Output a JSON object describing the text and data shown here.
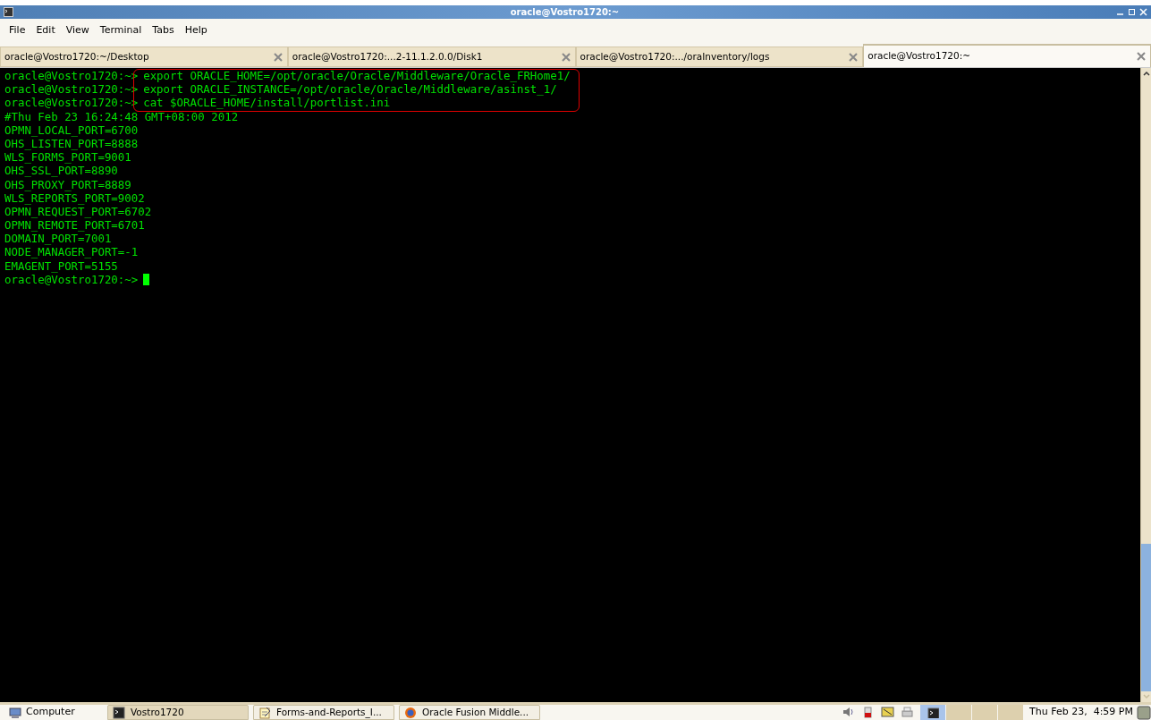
{
  "window": {
    "title": "oracle@Vostro1720:~"
  },
  "menu": [
    "File",
    "Edit",
    "View",
    "Terminal",
    "Tabs",
    "Help"
  ],
  "tabs": [
    {
      "label": "oracle@Vostro1720:~/Desktop",
      "selected": false
    },
    {
      "label": "oracle@Vostro1720:...2-11.1.2.0.0/Disk1",
      "selected": false
    },
    {
      "label": "oracle@Vostro1720:.../oraInventory/logs",
      "selected": false
    },
    {
      "label": "oracle@Vostro1720:~",
      "selected": true
    }
  ],
  "terminal": {
    "lines": [
      {
        "prompt": "oracle@Vostro1720:~>",
        "text": "export ORACLE_HOME=/opt/oracle/Oracle/Middleware/Oracle_FRHome1/",
        "highlighted": true
      },
      {
        "prompt": "oracle@Vostro1720:~>",
        "text": "export ORACLE_INSTANCE=/opt/oracle/Oracle/Middleware/asinst_1/",
        "highlighted": true
      },
      {
        "prompt": "oracle@Vostro1720:~>",
        "text": "cat $ORACLE_HOME/install/portlist.ini",
        "highlighted": true
      },
      {
        "text": "#Thu Feb 23 16:24:48 GMT+08:00 2012",
        "highlighted": false
      },
      {
        "text": "OPMN_LOCAL_PORT=6700",
        "highlighted": false
      },
      {
        "text": "OHS_LISTEN_PORT=8888",
        "highlighted": false
      },
      {
        "text": "WLS_FORMS_PORT=9001",
        "highlighted": false
      },
      {
        "text": "OHS_SSL_PORT=8890",
        "highlighted": false
      },
      {
        "text": "OHS_PROXY_PORT=8889",
        "highlighted": false
      },
      {
        "text": "WLS_REPORTS_PORT=9002",
        "highlighted": false
      },
      {
        "text": "OPMN_REQUEST_PORT=6702",
        "highlighted": false
      },
      {
        "text": "OPMN_REMOTE_PORT=6701",
        "highlighted": false
      },
      {
        "text": "DOMAIN_PORT=7001",
        "highlighted": false
      },
      {
        "text": "NODE_MANAGER_PORT=-1",
        "highlighted": false
      },
      {
        "text": "EMAGENT_PORT=5155",
        "highlighted": false
      },
      {
        "prompt": "oracle@Vostro1720:~>",
        "cursor": true,
        "highlighted": false
      }
    ]
  },
  "taskbar": {
    "launcher": "Computer",
    "tasks": [
      {
        "label": "Vostro1720",
        "kind": "terminal",
        "selected": true
      },
      {
        "label": "Forms-and-Reports_I...",
        "kind": "editor",
        "selected": false
      },
      {
        "label": "Oracle Fusion Middle...",
        "kind": "browser",
        "selected": false
      }
    ],
    "workspaces": [
      {
        "selected": true
      },
      {
        "selected": false
      },
      {
        "selected": false
      },
      {
        "selected": false
      }
    ],
    "clock": "Thu Feb 23,  4:59 PM"
  }
}
